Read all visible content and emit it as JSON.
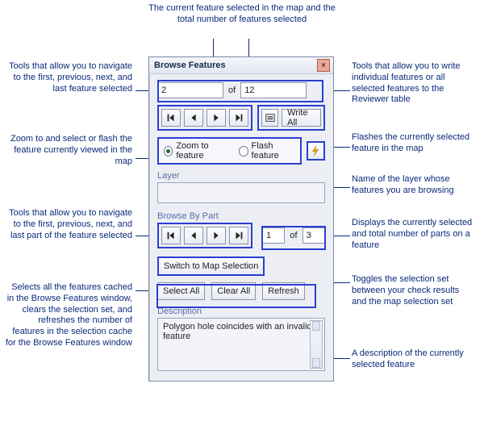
{
  "captions": {
    "top": "The current feature selected in the map and the total number of features selected",
    "left_nav": "Tools that allow you to navigate to the first, previous, next, and last feature selected",
    "left_zoom": "Zoom to and select or flash the feature currently viewed in the map",
    "left_part_nav": "Tools that allow you to navigate to the first, previous, next, and last part of the feature selected",
    "left_cache": "Selects all the features cached in the Browse Features window, clears the selection set, and refreshes the number of features in the selection cache for the Browse Features window",
    "right_write": "Tools that allow you to write individual features or all selected features to the Reviewer table",
    "right_flash": "Flashes the currently selected feature in the map",
    "right_layer": "Name of the layer whose features you are browsing",
    "right_parts": "Displays the currently selected and total number of parts on a feature",
    "right_toggle": "Toggles the selection set between your check results and the map selection set",
    "right_desc": "A description of the currently selected feature"
  },
  "panel": {
    "title": "Browse Features",
    "close": "×",
    "counter": {
      "current": "2",
      "of": "of",
      "total": "12"
    },
    "write_all": "Write All",
    "radio": {
      "zoom": "Zoom to feature",
      "flash": "Flash feature"
    },
    "layer_label": "Layer",
    "browse_by_part": "Browse By Part",
    "part_counter": {
      "current": "1",
      "of": "of",
      "total": "3"
    },
    "switch_btn": "Switch to Map Selection",
    "select_all": "Select All",
    "clear_all": "Clear All",
    "refresh": "Refresh",
    "desc_label": "Description",
    "desc_text": "Polygon hole coincides with an invalid feature"
  }
}
